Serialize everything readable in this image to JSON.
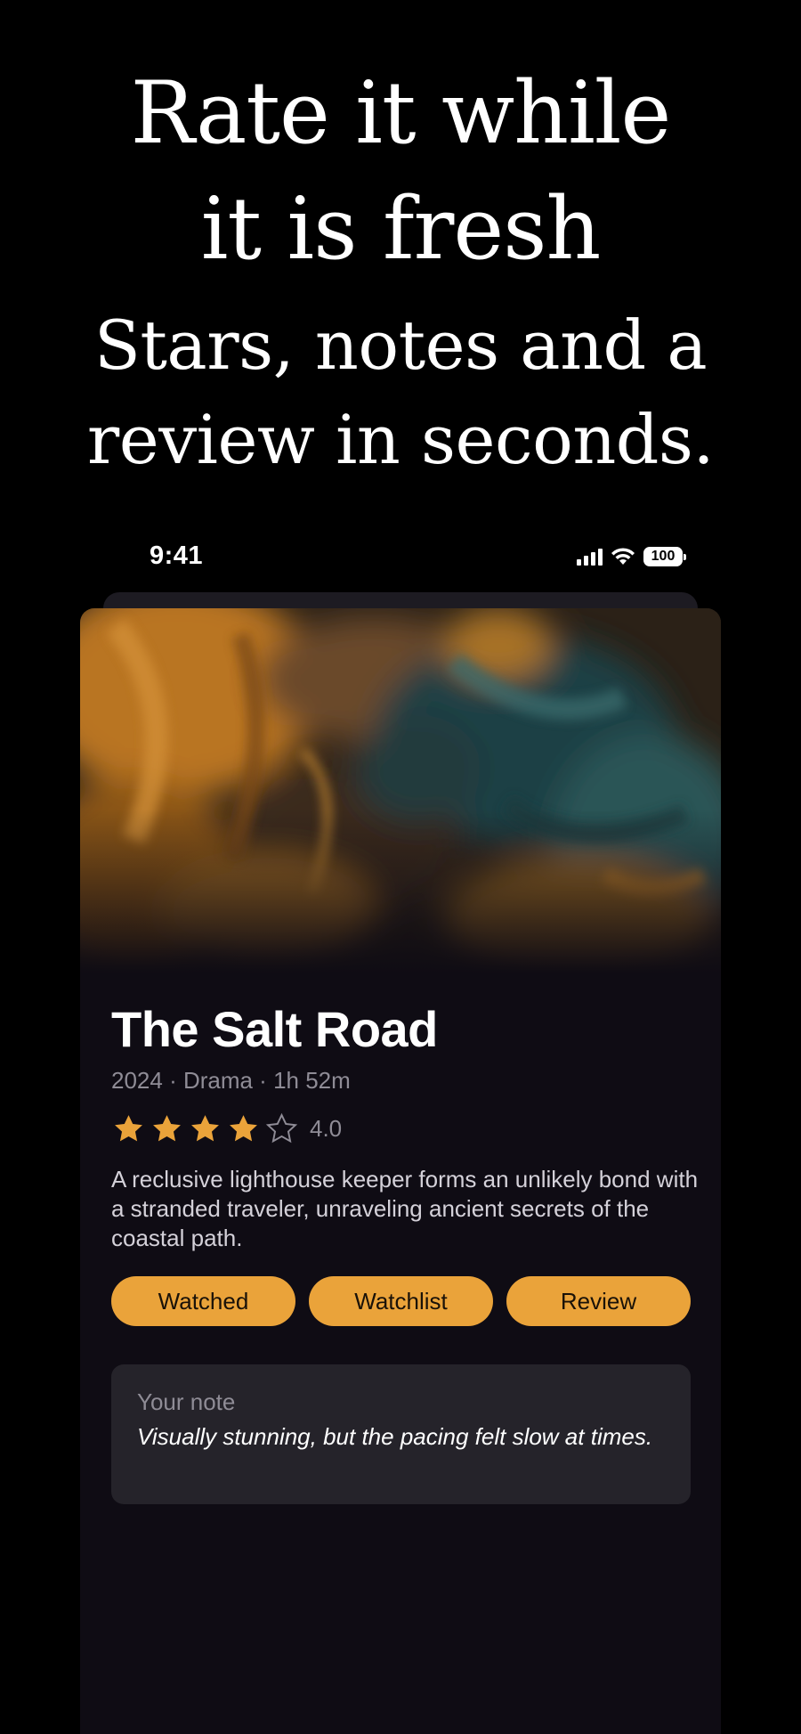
{
  "promo": {
    "headline_line1": "Rate it while",
    "headline_line2": "it is fresh",
    "subhead_line1": "Stars, notes and a",
    "subhead_line2": "review in seconds."
  },
  "status_bar": {
    "time": "9:41",
    "battery": "100",
    "icons": [
      "cellular-signal-icon",
      "wifi-icon",
      "battery-icon"
    ]
  },
  "movie": {
    "title": "The Salt Road",
    "meta": "2024 · Drama · 1h 52m",
    "rating": 4.0,
    "rating_label": "4.0",
    "rating_max": 5,
    "synopsis": "A reclusive lighthouse keeper forms an unlikely bond with a stranded traveler, unraveling ancient secrets of the coastal path."
  },
  "actions": {
    "watched_label": "Watched",
    "watchlist_label": "Watchlist",
    "review_label": "Review"
  },
  "note": {
    "label": "Your note",
    "text": "Visually stunning, but the pacing felt slow at times."
  },
  "colors": {
    "background": "#000000",
    "card": "#0f0c14",
    "accent": "#eaa33a",
    "note_box": "#25232a",
    "muted_text": "#8f8c96"
  }
}
